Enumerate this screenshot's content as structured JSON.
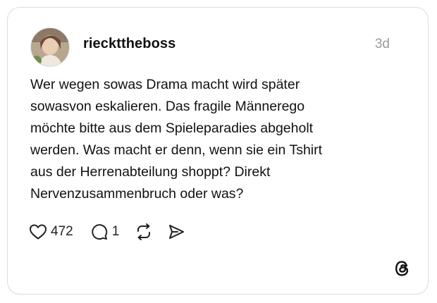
{
  "post": {
    "username": "rieckttheboss",
    "timestamp": "3d",
    "text_lines": [
      "Wer wegen sowas Drama macht wird später",
      "sowasvon eskalieren. Das fragile Männerego",
      "möchte bitte aus dem Spieleparadies abgeholt",
      "werden. Was macht er denn, wenn sie ein Tshirt",
      "aus der Herrenabteilung shoppt? Direkt",
      "Nervenzusammenbruch oder was?"
    ],
    "likes": "472",
    "replies": "1"
  },
  "icons": {
    "like": "heart-icon",
    "reply": "speech-bubble-icon",
    "repost": "repost-icon",
    "share": "send-icon",
    "brand": "threads-logo-icon"
  }
}
